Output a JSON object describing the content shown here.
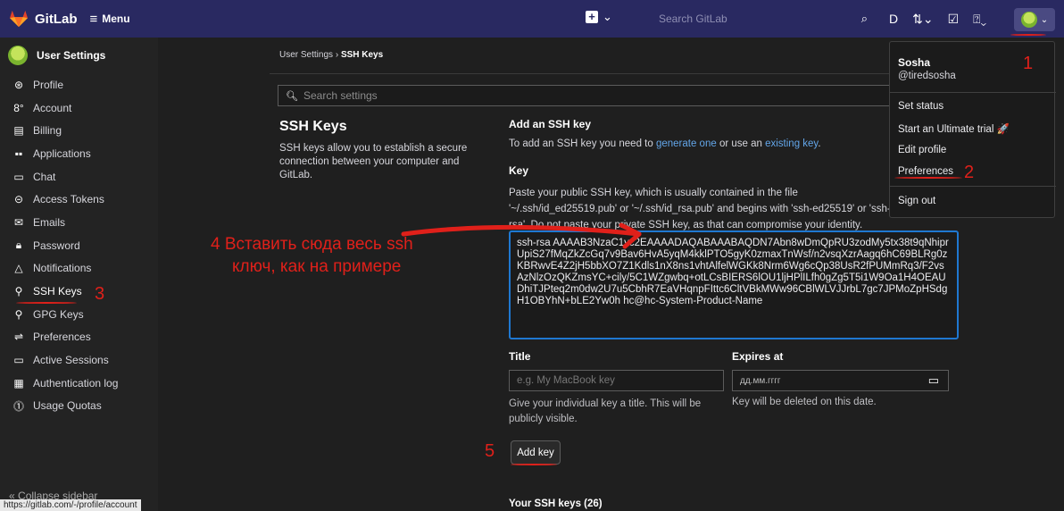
{
  "topbar": {
    "brand": "GitLab",
    "menu_label": "Menu",
    "new_caret": "⌄",
    "search_placeholder": "Search GitLab"
  },
  "sidebar": {
    "title": "User Settings",
    "items": [
      {
        "label": "Profile",
        "icon": "profile-icon"
      },
      {
        "label": "Account",
        "icon": "account-icon"
      },
      {
        "label": "Billing",
        "icon": "billing-icon"
      },
      {
        "label": "Applications",
        "icon": "applications-icon"
      },
      {
        "label": "Chat",
        "icon": "chat-icon"
      },
      {
        "label": "Access Tokens",
        "icon": "token-icon"
      },
      {
        "label": "Emails",
        "icon": "email-icon"
      },
      {
        "label": "Password",
        "icon": "lock-icon"
      },
      {
        "label": "Notifications",
        "icon": "bell-icon"
      },
      {
        "label": "SSH Keys",
        "icon": "key-icon"
      },
      {
        "label": "GPG Keys",
        "icon": "key-icon"
      },
      {
        "label": "Preferences",
        "icon": "preferences-icon"
      },
      {
        "label": "Active Sessions",
        "icon": "monitor-icon"
      },
      {
        "label": "Authentication log",
        "icon": "log-icon"
      },
      {
        "label": "Usage Quotas",
        "icon": "quota-icon"
      }
    ],
    "collapse_label": "Collapse sidebar"
  },
  "status_url": "https://gitlab.com/-/profile/account",
  "breadcrumb": {
    "parent": "User Settings",
    "separator": "›",
    "current": "SSH Keys"
  },
  "settings_search_placeholder": "Search settings",
  "section": {
    "title": "SSH Keys",
    "description": "SSH keys allow you to establish a secure connection between your computer and GitLab."
  },
  "add_key": {
    "heading": "Add an SSH key",
    "desc_prefix": "To add an SSH key you need to ",
    "link1": "generate one",
    "desc_mid": " or use an ",
    "link2": "existing key",
    "desc_suffix": ".",
    "key_label": "Key",
    "key_help": "Paste your public SSH key, which is usually contained in the file '~/.ssh/id_ed25519.pub' or '~/.ssh/id_rsa.pub' and begins with 'ssh-ed25519' or 'ssh-rsa'. Do not paste your private SSH key, as that can compromise your identity.",
    "key_value": "ssh-rsa AAAAB3NzaC1yc2EAAAADAQABAAABAQDN7Abn8wDmQpRU3zodMy5tx38t9qNhiprUpiS27fMqZkZcGq7v9Bav6HvA5yqM4kklPTO5gyK0zmaxTnWsf/n2vsqXzrAagq6hC69BLRg0zKBRwvE4Z2jH5bbXO7Z1Kdls1nX8ns1vhtAlfelWGKk8Nrm6Wg6cQp38UsR2fPUMmRq3/F2vsAzNlzOzQKZmsYC+cily/5C1WZgwbq+otLCsBIERS6lOU1ljHPlILfh0gZg5T5i1W9Oa1H4OEAUDhiTJPteq2m0dw2U7u5CbhR7EaVHqnpFIttc6CltVBkMWw96CBlWLVJJrbL7gc7JPMoZpHSdgH1OBYhN+bLE2Yw0h hc@hc-System-Product-Name",
    "title_label": "Title",
    "title_placeholder": "e.g. My MacBook key",
    "title_help": "Give your individual key a title. This will be publicly visible.",
    "expires_label": "Expires at",
    "expires_placeholder": "дд.мм.гггг",
    "expires_help": "Key will be deleted on this date.",
    "button": "Add key",
    "your_keys": "Your SSH keys (26)"
  },
  "dropdown": {
    "name": "Sosha",
    "handle": "@tiredsosha",
    "items": [
      "Set status",
      "Start an Ultimate trial 🚀",
      "Edit profile",
      "Preferences",
      "Sign out"
    ]
  },
  "annotations": {
    "n1": "1",
    "n2": "2",
    "n3": "3",
    "n4": "4",
    "n5": "5",
    "instruction_line1": "Вставить сюда весь ssh",
    "instruction_line2": "ключ, как на примере",
    "color": "#e0201a"
  },
  "colors": {
    "topbar": "#292961",
    "accent_link": "#63a6e9",
    "focus": "#1f78d1"
  }
}
